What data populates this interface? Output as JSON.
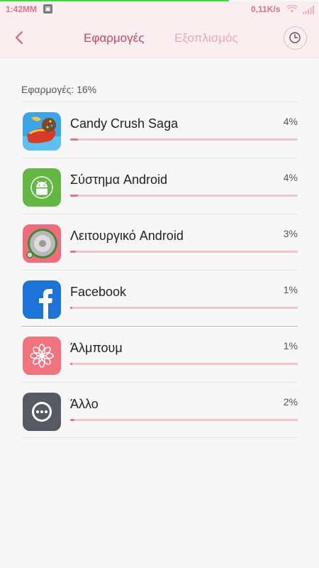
{
  "status": {
    "time": "1:42MM",
    "speed": "0,11K/s"
  },
  "header": {
    "tab_apps": "Εφαρμογές",
    "tab_hardware": "Εξοπλισμός"
  },
  "summary": "Εφαρμογές: 16%",
  "apps": [
    {
      "name": "Candy Crush Saga",
      "percent": "4%",
      "usage": 4,
      "icon": "candy-crush-icon"
    },
    {
      "name": "Σύστημα Android",
      "percent": "4%",
      "usage": 4,
      "icon": "android-system-icon"
    },
    {
      "name": "Λειτουργικό Android",
      "percent": "3%",
      "usage": 3,
      "icon": "android-os-icon"
    },
    {
      "name": "Facebook",
      "percent": "1%",
      "usage": 1,
      "icon": "facebook-icon"
    },
    {
      "name": "Άλμπουμ",
      "percent": "1%",
      "usage": 1,
      "icon": "album-icon"
    },
    {
      "name": "Άλλο",
      "percent": "2%",
      "usage": 2,
      "icon": "other-icon"
    }
  ],
  "colors": {
    "accent": "#c9486a",
    "bar_fill": "#e8738a",
    "bar_track": "#f4c2c9",
    "header_bg": "#fbeef0"
  }
}
